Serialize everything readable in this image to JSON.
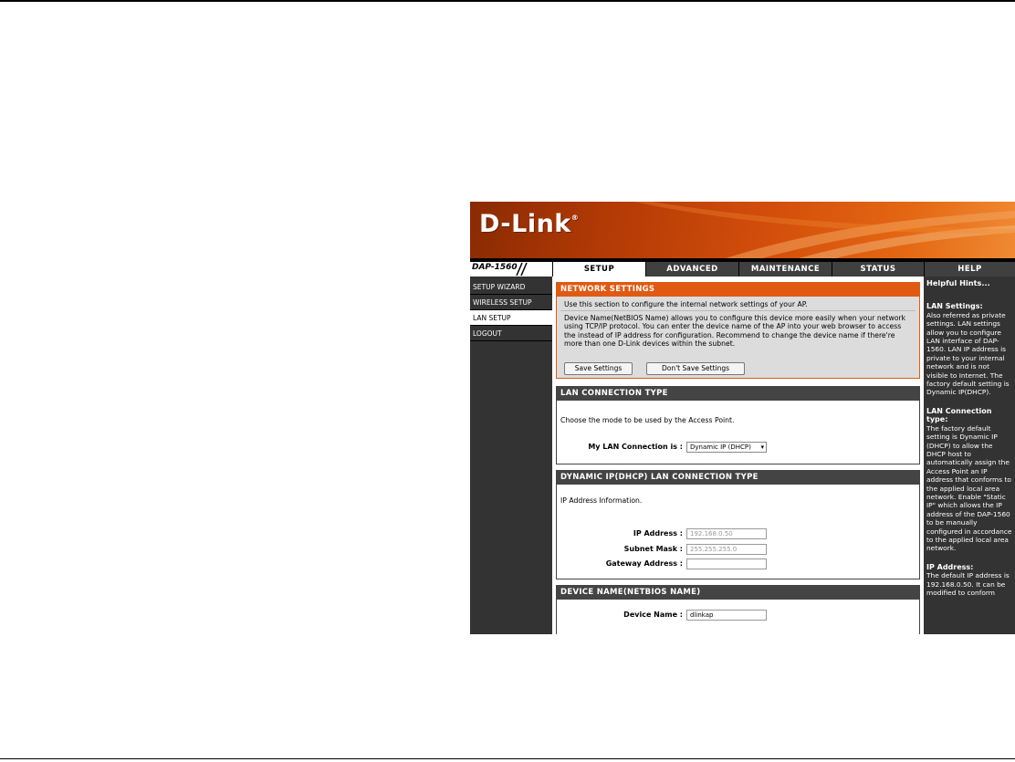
{
  "brand": {
    "logo": "D-Link",
    "model": "DAP-1560"
  },
  "nav": {
    "tabs": [
      "SETUP",
      "ADVANCED",
      "MAINTENANCE",
      "STATUS",
      "HELP"
    ]
  },
  "sidebar": {
    "items": [
      "SETUP WIZARD",
      "WIRELESS SETUP",
      "LAN SETUP",
      "LOGOUT"
    ]
  },
  "network_settings": {
    "title": "NETWORK SETTINGS",
    "intro": "Use this section to configure the internal network settings of your AP.",
    "description": "Device Name(NetBIOS Name) allows you to configure this device more easily when your network using TCP/IP protocol. You can enter the device name of the AP into your web browser to access the instead of IP address for configuration. Recommend to change the device name if there're more than one D-Link devices within the subnet.",
    "save_label": "Save Settings",
    "dont_save_label": "Don't Save Settings"
  },
  "lan_connection": {
    "title": "LAN CONNECTION TYPE",
    "prompt": "Choose the mode to be used by the Access Point.",
    "label": "My LAN Connection is :",
    "selected": "Dynamic IP (DHCP)"
  },
  "dhcp": {
    "title": "DYNAMIC IP(DHCP) LAN CONNECTION TYPE",
    "info": "IP Address Information.",
    "ip_label": "IP Address :",
    "ip_value": "192.168.0.50",
    "mask_label": "Subnet Mask :",
    "mask_value": "255.255.255.0",
    "gateway_label": "Gateway Address :",
    "gateway_value": ""
  },
  "device_name": {
    "title": "DEVICE NAME(NETBIOS NAME)",
    "label": "Device Name :",
    "value": "dlinkap"
  },
  "hints": {
    "title": "Helpful Hints...",
    "sections": [
      {
        "heading": "LAN Settings:",
        "text": "Also referred as private settings. LAN settings allow you to configure LAN interface of DAP-1560. LAN IP address is private to your internal network and is not visible to Internet. The factory default setting is Dynamic IP(DHCP)."
      },
      {
        "heading": "LAN Connection type:",
        "text": "The factory default setting is Dynamic IP (DHCP) to allow the DHCP host to automatically assign the Access Point an IP address that conforms to the applied local area network. Enable \"Static IP\" which allows the IP address of the DAP-1560 to be manually configured in accordance to the applied local area network."
      },
      {
        "heading": "IP Address:",
        "text": "The default IP address is 192.168.0.50. It can be modified to conform"
      }
    ]
  },
  "colors": {
    "accent": "#e05a13",
    "panel": "#333333",
    "header": "#444444"
  }
}
